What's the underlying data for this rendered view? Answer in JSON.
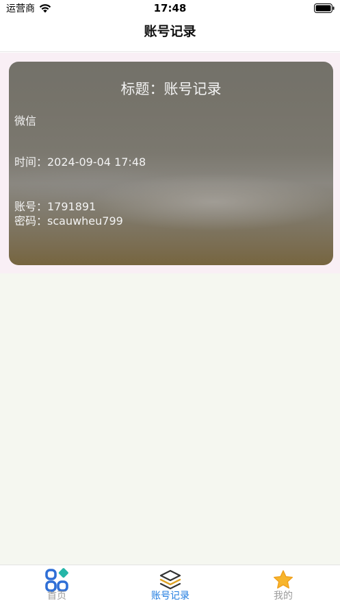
{
  "status_bar": {
    "carrier": "运营商",
    "time": "17:48"
  },
  "nav": {
    "title": "账号记录"
  },
  "record": {
    "title": "标题：账号记录",
    "category": "微信",
    "time": "时间：2024-09-04 17:48",
    "account": "账号：1791891",
    "password": "密码：scauwheu799"
  },
  "tabs": [
    {
      "label": "首页",
      "icon": "apps-icon",
      "active": false
    },
    {
      "label": "账号记录",
      "icon": "layers-icon",
      "active": true
    },
    {
      "label": "我的",
      "icon": "star-icon",
      "active": false
    }
  ],
  "colors": {
    "active_tab": "#1e7be0",
    "inactive_tab": "#9a9a9a",
    "list_background": "#f9eff5",
    "page_background": "#f5f7f0"
  }
}
